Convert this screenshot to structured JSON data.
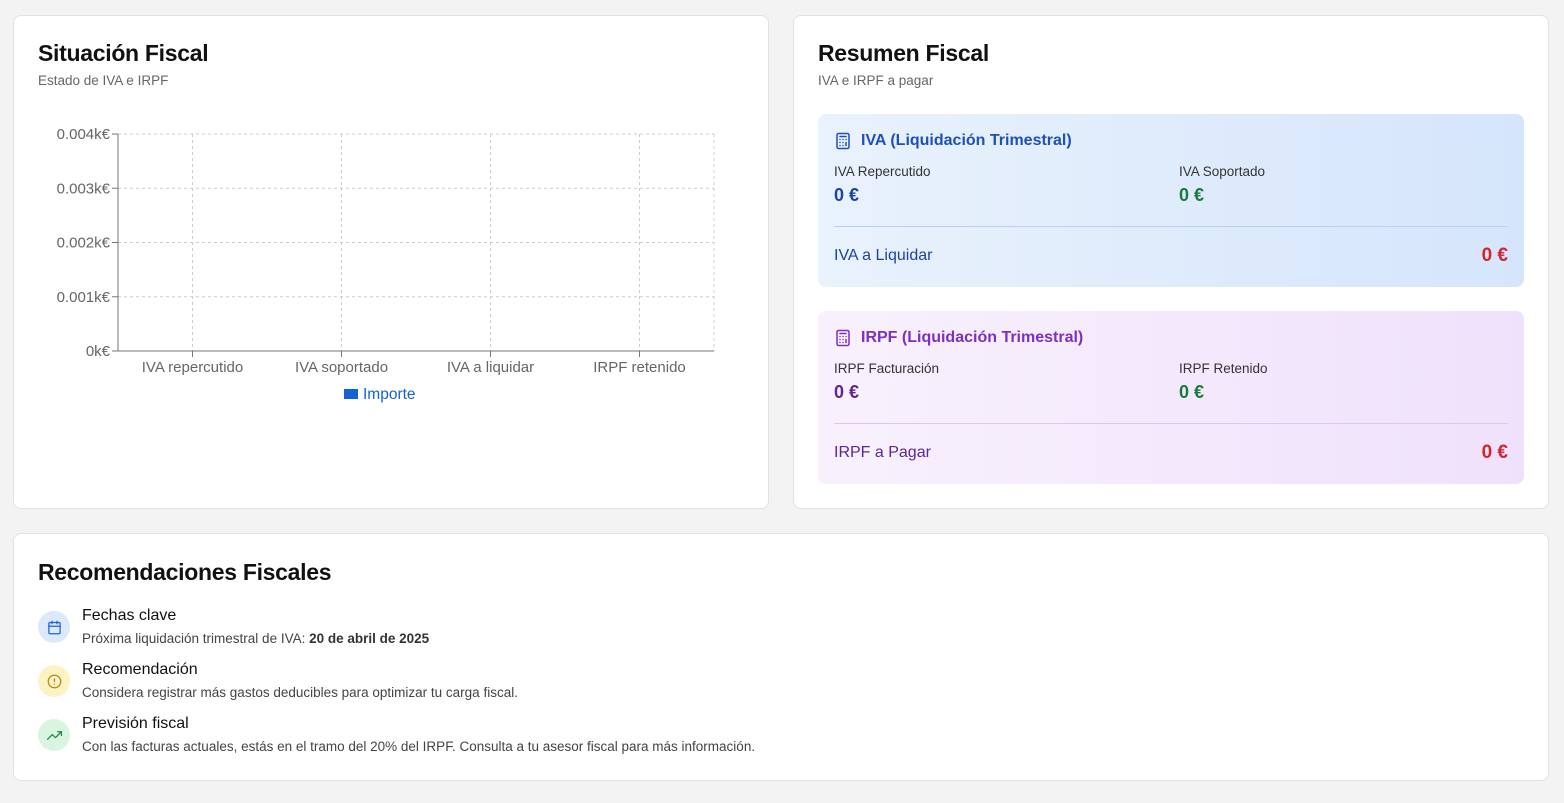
{
  "chart_card": {
    "title": "Situación Fiscal",
    "subtitle": "Estado de IVA e IRPF"
  },
  "chart_data": {
    "type": "bar",
    "categories": [
      "IVA repercutido",
      "IVA soportado",
      "IVA a liquidar",
      "IRPF retenido"
    ],
    "series": [
      {
        "name": "Importe",
        "values": [
          0,
          0,
          0,
          0
        ],
        "color": "#1462d8"
      }
    ],
    "yticks": [
      "0k€",
      "0.001k€",
      "0.002k€",
      "0.003k€",
      "0.004k€"
    ],
    "ylim": [
      0,
      0.004
    ],
    "grid": true,
    "legend": "bottom"
  },
  "summary_card": {
    "title": "Resumen Fiscal",
    "subtitle": "IVA e IRPF a pagar",
    "iva": {
      "heading": "IVA (Liquidación Trimestral)",
      "icon": "calculator-icon",
      "repercutido_label": "IVA Repercutido",
      "repercutido_value": "0 €",
      "soportado_label": "IVA Soportado",
      "soportado_value": "0 €",
      "total_label": "IVA a Liquidar",
      "total_value": "0 €"
    },
    "irpf": {
      "heading": "IRPF (Liquidación Trimestral)",
      "icon": "calculator-icon",
      "facturacion_label": "IRPF Facturación",
      "facturacion_value": "0 €",
      "retenido_label": "IRPF Retenido",
      "retenido_value": "0 €",
      "total_label": "IRPF a Pagar",
      "total_value": "0 €"
    }
  },
  "reco_card": {
    "title": "Recomendaciones Fiscales",
    "items": [
      {
        "icon": "calendar-icon",
        "title": "Fechas clave",
        "text": "Próxima liquidación trimestral de IVA: ",
        "strong": "20 de abril de 2025"
      },
      {
        "icon": "alert-circle-icon",
        "title": "Recomendación",
        "text": "Considera registrar más gastos deducibles para optimizar tu carga fiscal."
      },
      {
        "icon": "trending-up-icon",
        "title": "Previsión fiscal",
        "text": "Con las facturas actuales, estás en el tramo del 20% del IRPF. Consulta a tu asesor fiscal para más información."
      }
    ]
  },
  "colors": {
    "accent_blue": "#1462d8",
    "negative_red": "#d6242c",
    "positive_green": "#1a7a3c",
    "irpf_purple": "#7c2fc2"
  }
}
